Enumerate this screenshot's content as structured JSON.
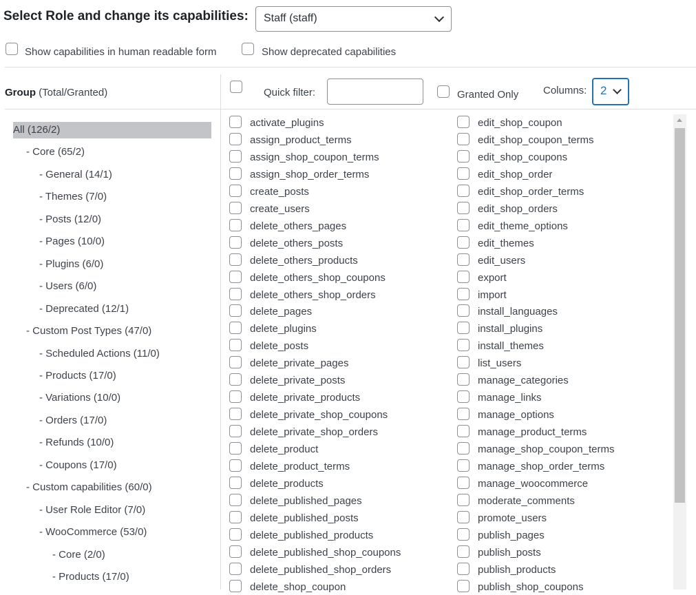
{
  "header": {
    "title": "Select Role and change its capabilities:",
    "role_selected": "Staff (staff)"
  },
  "options": {
    "human_readable": "Show capabilities in human readable form",
    "show_deprecated": "Show deprecated capabilities"
  },
  "group_header": {
    "bold": "Group",
    "rest": " (Total/Granted)"
  },
  "toolbar": {
    "quick_filter_label": "Quick filter:",
    "quick_filter_value": "",
    "granted_only": "Granted Only",
    "columns_label": "Columns:",
    "columns_value": "2"
  },
  "groups": [
    {
      "label": "All (126/2)",
      "level": 0,
      "selected": true
    },
    {
      "label": "- Core (65/2)",
      "level": 1
    },
    {
      "label": "- General (14/1)",
      "level": 2
    },
    {
      "label": "- Themes (7/0)",
      "level": 2
    },
    {
      "label": "- Posts (12/0)",
      "level": 2
    },
    {
      "label": "- Pages (10/0)",
      "level": 2
    },
    {
      "label": "- Plugins (6/0)",
      "level": 2
    },
    {
      "label": "- Users (6/0)",
      "level": 2
    },
    {
      "label": "- Deprecated (12/1)",
      "level": 2
    },
    {
      "label": "- Custom Post Types (47/0)",
      "level": 1
    },
    {
      "label": "- Scheduled Actions (11/0)",
      "level": 2
    },
    {
      "label": "- Products (17/0)",
      "level": 2
    },
    {
      "label": "- Variations (10/0)",
      "level": 2
    },
    {
      "label": "- Orders (17/0)",
      "level": 2
    },
    {
      "label": "- Refunds (10/0)",
      "level": 2
    },
    {
      "label": "- Coupons (17/0)",
      "level": 2
    },
    {
      "label": "- Custom capabilities (60/0)",
      "level": 1
    },
    {
      "label": "- User Role Editor (7/0)",
      "level": 2
    },
    {
      "label": "- WooCommerce (53/0)",
      "level": 2
    },
    {
      "label": "- Core (2/0)",
      "level": 3
    },
    {
      "label": "- Products (17/0)",
      "level": 3
    }
  ],
  "capabilities_col1": [
    "activate_plugins",
    "assign_product_terms",
    "assign_shop_coupon_terms",
    "assign_shop_order_terms",
    "create_posts",
    "create_users",
    "delete_others_pages",
    "delete_others_posts",
    "delete_others_products",
    "delete_others_shop_coupons",
    "delete_others_shop_orders",
    "delete_pages",
    "delete_plugins",
    "delete_posts",
    "delete_private_pages",
    "delete_private_posts",
    "delete_private_products",
    "delete_private_shop_coupons",
    "delete_private_shop_orders",
    "delete_product",
    "delete_product_terms",
    "delete_products",
    "delete_published_pages",
    "delete_published_posts",
    "delete_published_products",
    "delete_published_shop_coupons",
    "delete_published_shop_orders",
    "delete_shop_coupon"
  ],
  "capabilities_col2": [
    "edit_shop_coupon",
    "edit_shop_coupon_terms",
    "edit_shop_coupons",
    "edit_shop_order",
    "edit_shop_order_terms",
    "edit_shop_orders",
    "edit_theme_options",
    "edit_themes",
    "edit_users",
    "export",
    "import",
    "install_languages",
    "install_plugins",
    "install_themes",
    "list_users",
    "manage_categories",
    "manage_links",
    "manage_options",
    "manage_product_terms",
    "manage_shop_coupon_terms",
    "manage_shop_order_terms",
    "manage_woocommerce",
    "moderate_comments",
    "promote_users",
    "publish_pages",
    "publish_posts",
    "publish_products",
    "publish_shop_coupons"
  ]
}
